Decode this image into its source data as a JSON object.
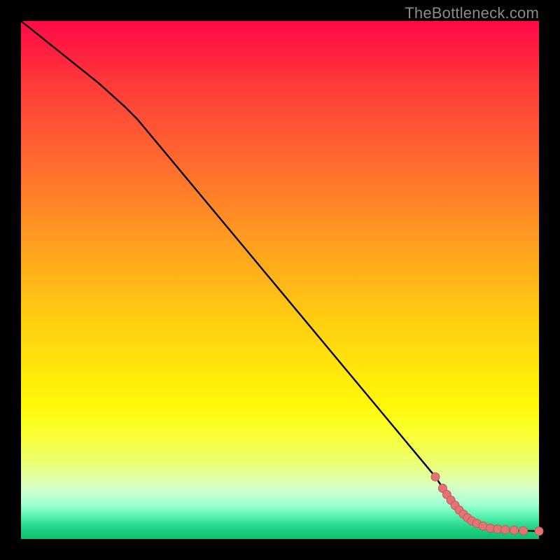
{
  "watermark": "TheBottleneck.com",
  "colors": {
    "line": "#000000",
    "dot_fill": "#e57373",
    "dot_stroke": "#c05a5a"
  },
  "chart_data": {
    "type": "line",
    "title": "",
    "xlabel": "",
    "ylabel": "",
    "xlim": [
      0,
      100
    ],
    "ylim": [
      0,
      100
    ],
    "grid": false,
    "series": [
      {
        "name": "curve",
        "x": [
          0,
          5,
          10,
          15,
          20,
          22.5,
          25,
          27.5,
          30,
          35,
          40,
          45,
          50,
          55,
          60,
          65,
          70,
          75,
          80,
          83,
          85,
          87.5,
          90,
          92.5,
          95,
          97.5,
          100
        ],
        "values": [
          100,
          96,
          92,
          88,
          83.5,
          81,
          78,
          75,
          72,
          66,
          60,
          54,
          48,
          42,
          36,
          30,
          24,
          18,
          12,
          7.5,
          5,
          3.2,
          2.2,
          1.7,
          1.6,
          1.6,
          1.5
        ]
      }
    ],
    "dots": {
      "name": "highlight-dots",
      "points": [
        {
          "x": 80.0,
          "y": 12.0
        },
        {
          "x": 81.4,
          "y": 9.8
        },
        {
          "x": 82.2,
          "y": 8.6
        },
        {
          "x": 83.0,
          "y": 7.5
        },
        {
          "x": 83.8,
          "y": 6.5
        },
        {
          "x": 84.6,
          "y": 5.6
        },
        {
          "x": 85.4,
          "y": 4.8
        },
        {
          "x": 86.2,
          "y": 4.1
        },
        {
          "x": 87.0,
          "y": 3.5
        },
        {
          "x": 88.0,
          "y": 3.0
        },
        {
          "x": 89.2,
          "y": 2.5
        },
        {
          "x": 90.6,
          "y": 2.1
        },
        {
          "x": 92.0,
          "y": 1.9
        },
        {
          "x": 93.5,
          "y": 1.8
        },
        {
          "x": 95.2,
          "y": 1.7
        },
        {
          "x": 97.0,
          "y": 1.6
        },
        {
          "x": 100.0,
          "y": 1.5
        }
      ]
    }
  }
}
